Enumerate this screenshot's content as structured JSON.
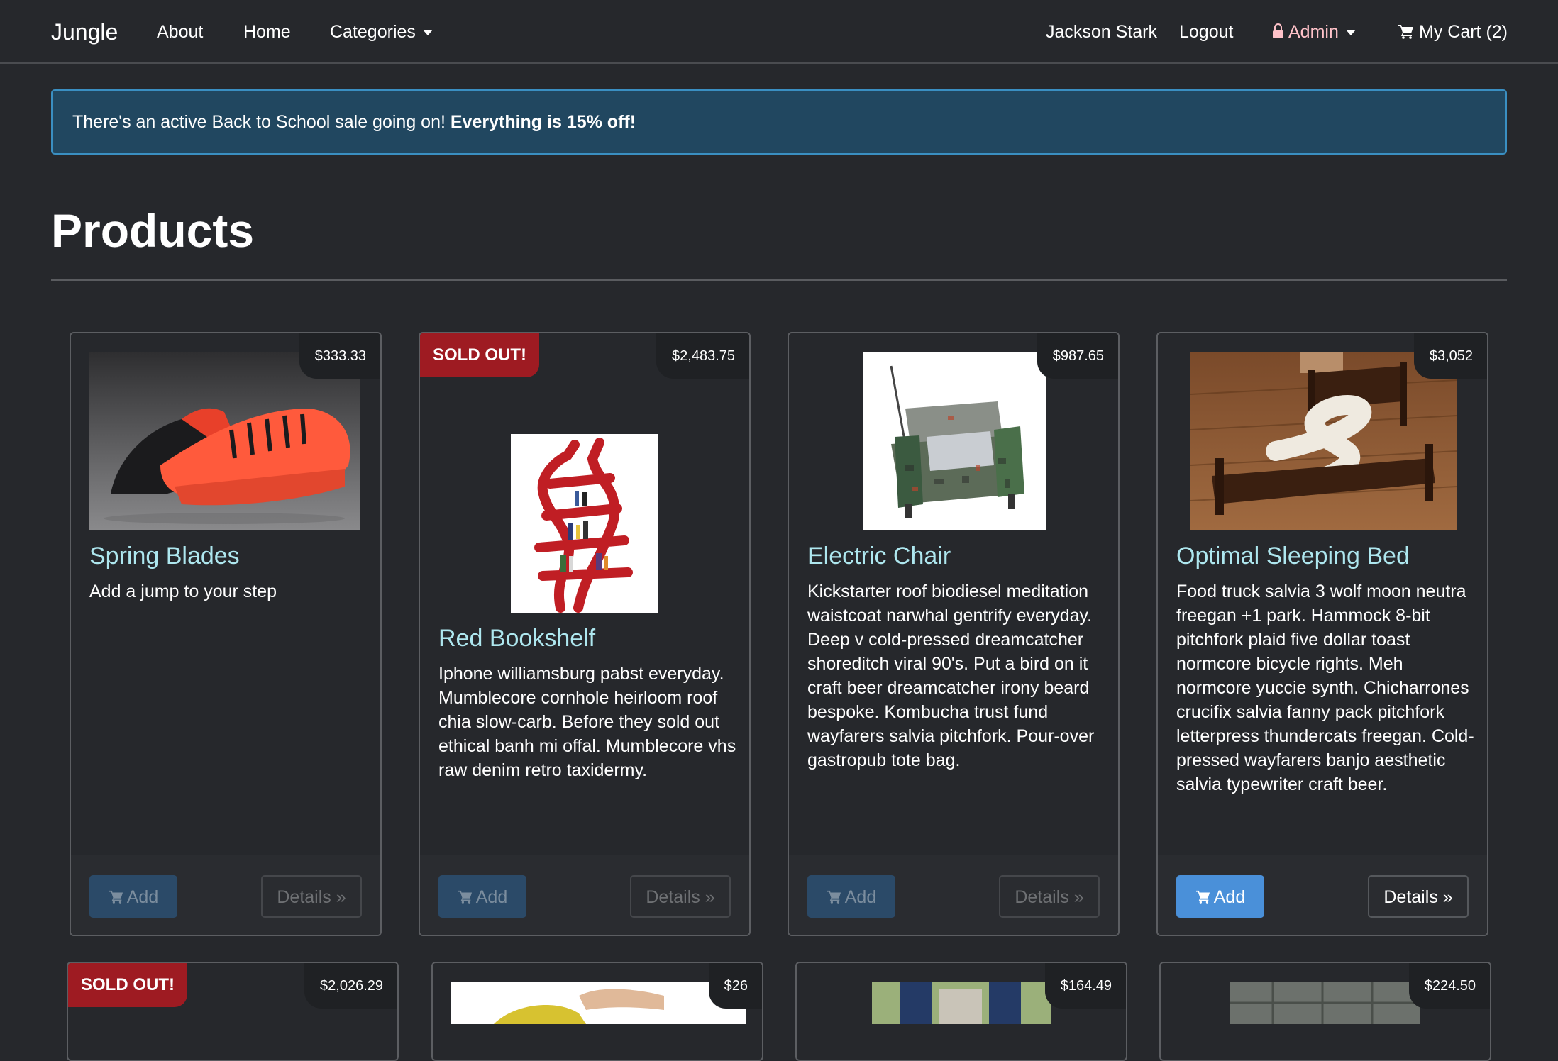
{
  "nav": {
    "brand": "Jungle",
    "links": [
      "About",
      "Home"
    ],
    "categories": "Categories",
    "user": "Jackson Stark",
    "logout": "Logout",
    "admin": "Admin",
    "cart": "My Cart (2)"
  },
  "alert": {
    "text": "There's an active Back to School sale going on! ",
    "emphasis": "Everything is 15% off!"
  },
  "page": {
    "title": "Products"
  },
  "buttons": {
    "add": "Add",
    "details": "Details »"
  },
  "products": [
    {
      "name": "Spring Blades",
      "price": "$333.33",
      "description": "Add a jump to your step",
      "sold_out": false,
      "image": "red-black-sneaker"
    },
    {
      "name": "Red Bookshelf",
      "price": "$2,483.75",
      "description": "Iphone williamsburg pabst everyday. Mumblecore cornhole heirloom roof chia slow-carb. Before they sold out ethical banh mi offal. Mumblecore vhs raw denim retro taxidermy.",
      "sold_out": true,
      "sold_label": "SOLD OUT!",
      "image": "red-tree-bookshelf"
    },
    {
      "name": "Electric Chair",
      "price": "$987.65",
      "description": "Kickstarter roof biodiesel meditation waistcoat narwhal gentrify everyday. Deep v cold-pressed dreamcatcher shoreditch viral 90's. Put a bird on it craft beer dreamcatcher irony beard bespoke. Kombucha trust fund wayfarers salvia pitchfork. Pour-over gastropub tote bag.",
      "sold_out": false,
      "image": "circuit-board-armchair"
    },
    {
      "name": "Optimal Sleeping Bed",
      "price": "$3,052",
      "description": "Food truck salvia 3 wolf moon neutra freegan +1 park. Hammock 8-bit pitchfork plaid five dollar toast normcore bicycle rights. Meh normcore yuccie synth. Chicharrones crucifix salvia fanny pack pitchfork letterpress thundercats freegan. Cold-pressed wayfarers banjo aesthetic salvia typewriter craft beer.",
      "sold_out": false,
      "image": "zigzag-bed"
    },
    {
      "price": "$2,026.29",
      "sold_out": true,
      "sold_label": "SOLD OUT!"
    },
    {
      "price": "$26"
    },
    {
      "price": "$164.49"
    },
    {
      "price": "$224.50"
    }
  ],
  "colors": {
    "background": "#26282c",
    "alert_bg": "#214760",
    "alert_border": "#3a8fc2",
    "title_link": "#aee7ef",
    "add_button": "#4a90d9",
    "sold_badge": "#9e1b22",
    "admin": "#ffc2c9"
  }
}
